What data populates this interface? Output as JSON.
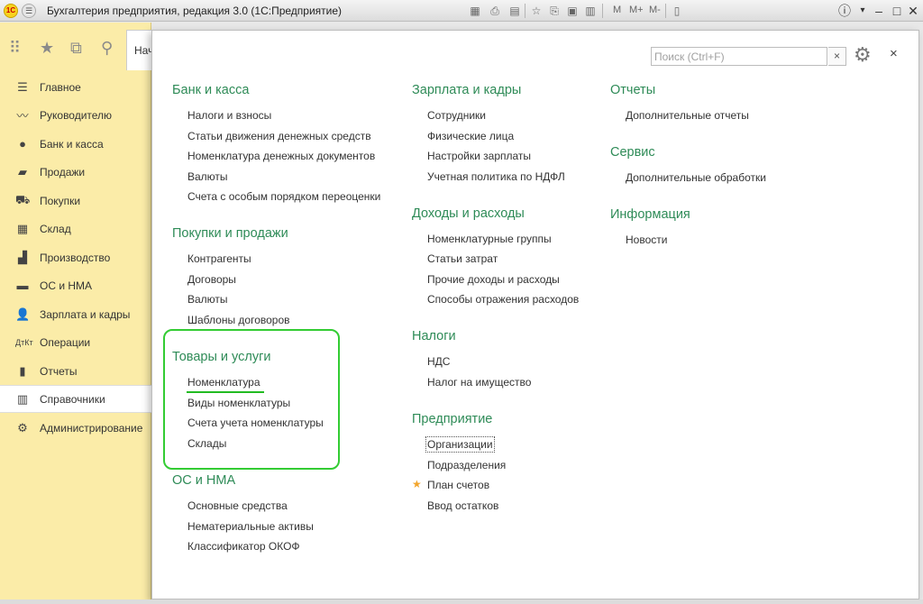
{
  "window": {
    "title": "Бухгалтерия предприятия, редакция 3.0  (1С:Предприятие)",
    "logo_text": "1С",
    "toolbar_text": [
      "M",
      "M+",
      "M-"
    ]
  },
  "tab": {
    "label": "Нач"
  },
  "sections": [
    {
      "label": "Главное",
      "icon": "menu-icon",
      "active": false
    },
    {
      "label": "Руководителю",
      "icon": "trend-icon",
      "active": false
    },
    {
      "label": "Банк и касса",
      "icon": "coin-icon",
      "active": false
    },
    {
      "label": "Продажи",
      "icon": "bag-icon",
      "active": false
    },
    {
      "label": "Покупки",
      "icon": "cart-icon",
      "active": false
    },
    {
      "label": "Склад",
      "icon": "warehouse-icon",
      "active": false
    },
    {
      "label": "Производство",
      "icon": "factory-icon",
      "active": false
    },
    {
      "label": "ОС и НМА",
      "icon": "truck-icon",
      "active": false
    },
    {
      "label": "Зарплата и кадры",
      "icon": "person-icon",
      "active": false
    },
    {
      "label": "Операции",
      "icon": "operations-icon",
      "active": false
    },
    {
      "label": "Отчеты",
      "icon": "bar-chart-icon",
      "active": false
    },
    {
      "label": "Справочники",
      "icon": "book-icon",
      "active": true
    },
    {
      "label": "Администрирование",
      "icon": "gear-icon",
      "active": false
    }
  ],
  "search": {
    "placeholder": "Поиск (Ctrl+F)",
    "clear": "×"
  },
  "close_label": "×",
  "columns": [
    [
      {
        "title": "Банк и касса",
        "items": [
          "Налоги и взносы",
          "Статьи движения денежных средств",
          "Номенклатура денежных документов",
          "Валюты",
          "Счета с особым порядком переоценки"
        ]
      },
      {
        "title": "Покупки и продажи",
        "items": [
          "Контрагенты",
          "Договоры",
          "Валюты",
          "Шаблоны договоров"
        ]
      },
      {
        "title": "Товары и услуги",
        "items": [
          "Номенклатура",
          "Виды номенклатуры",
          "Счета учета номенклатуры",
          "Склады"
        ]
      },
      {
        "title": "ОС и НМА",
        "items": [
          "Основные средства",
          "Нематериальные активы",
          "Классификатор ОКОФ"
        ]
      }
    ],
    [
      {
        "title": "Зарплата и кадры",
        "items": [
          "Сотрудники",
          "Физические лица",
          "Настройки зарплаты",
          "Учетная политика по НДФЛ"
        ]
      },
      {
        "title": "Доходы и расходы",
        "items": [
          "Номенклатурные группы",
          "Статьи затрат",
          "Прочие доходы и расходы",
          "Способы отражения расходов"
        ]
      },
      {
        "title": "Налоги",
        "items": [
          "НДС",
          "Налог на имущество"
        ]
      },
      {
        "title": "Предприятие",
        "items": [
          "Организации",
          "Подразделения",
          "План счетов",
          "Ввод остатков"
        ]
      }
    ],
    [
      {
        "title": "Отчеты",
        "items": [
          "Дополнительные отчеты"
        ]
      },
      {
        "title": "Сервис",
        "items": [
          "Дополнительные обработки"
        ]
      },
      {
        "title": "Информация",
        "items": [
          "Новости"
        ]
      }
    ]
  ]
}
